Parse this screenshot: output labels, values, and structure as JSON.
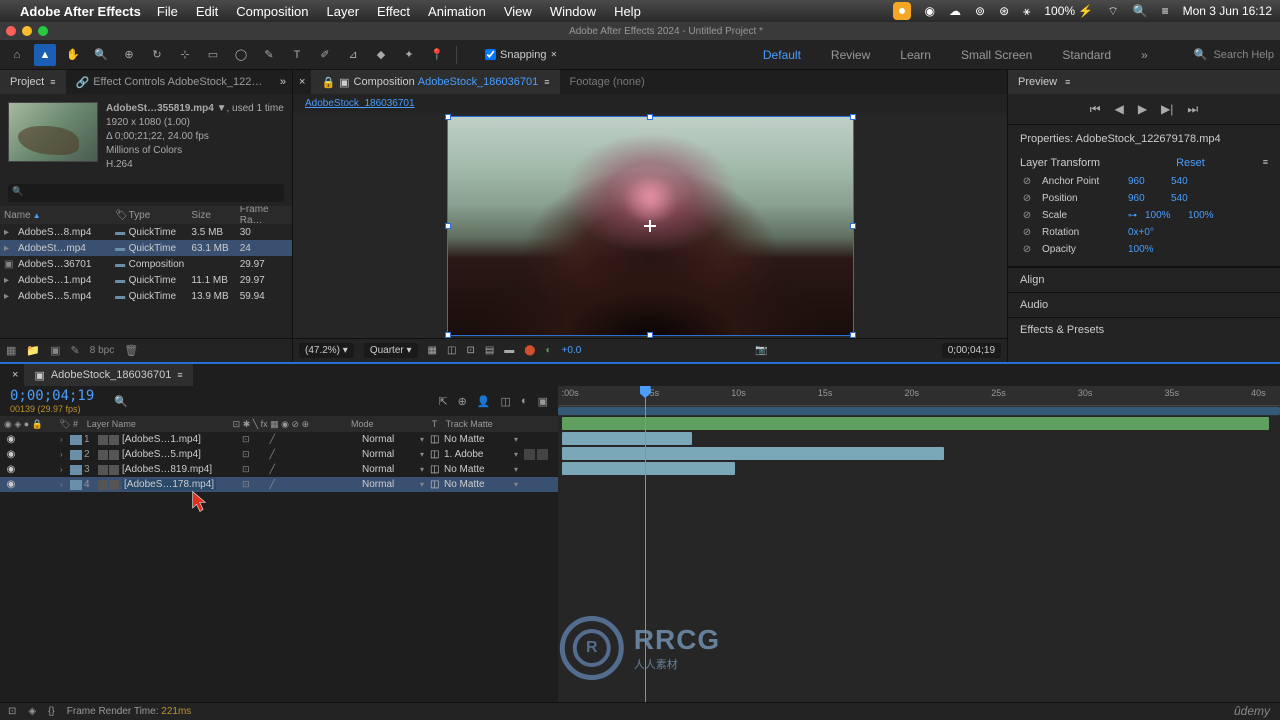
{
  "menubar": {
    "appname": "Adobe After Effects",
    "menus": [
      "File",
      "Edit",
      "Composition",
      "Layer",
      "Effect",
      "Animation",
      "View",
      "Window",
      "Help"
    ],
    "battery": "100%",
    "bt_icon": "⚡",
    "datetime": "Mon 3 Jun 16:12"
  },
  "window_title": "Adobe After Effects 2024 - Untitled Project *",
  "snapping_label": "Snapping",
  "workspaces": {
    "default": "Default",
    "review": "Review",
    "learn": "Learn",
    "small": "Small Screen",
    "standard": "Standard"
  },
  "search_help": "Search Help",
  "project": {
    "tab_project": "Project",
    "tab_effect_controls": "Effect Controls AdobeStock_122…",
    "thumb_info": {
      "name": "AdobeSt…355819.mp4 ▼",
      "used": ", used 1 time",
      "dims": "1920 x 1080 (1.00)",
      "dur": "Δ 0;00;21;22, 24.00 fps",
      "colors": "Millions of Colors",
      "codec": "H.264"
    },
    "search_placeholder": "",
    "cols": {
      "name": "Name",
      "type": "Type",
      "size": "Size",
      "fr": "Frame Ra…"
    },
    "rows": [
      {
        "name": "AdobeS…8.mp4",
        "type": "QuickTime",
        "size": "3.5 MB",
        "fr": "30",
        "sel": false
      },
      {
        "name": "AdobeSt…mp4",
        "type": "QuickTime",
        "size": "63.1 MB",
        "fr": "24",
        "sel": true
      },
      {
        "name": "AdobeS…36701",
        "type": "Composition",
        "size": "",
        "fr": "29.97",
        "sel": false
      },
      {
        "name": "AdobeS…1.mp4",
        "type": "QuickTime",
        "size": "11.1 MB",
        "fr": "29.97",
        "sel": false
      },
      {
        "name": "AdobeS…5.mp4",
        "type": "QuickTime",
        "size": "13.9 MB",
        "fr": "59.94",
        "sel": false
      }
    ],
    "bpc": "8 bpc"
  },
  "comp": {
    "tab_label": "Composition",
    "tab_name": "AdobeStock_186036701",
    "footage_tab": "Footage (none)",
    "crumb": "AdobeStock_186036701",
    "zoom": "(47.2%)",
    "quality": "Quarter",
    "exposure": "+0.0",
    "timecode": "0;00;04;19"
  },
  "preview": {
    "title": "Preview"
  },
  "properties": {
    "title": "Properties: AdobeStock_122679178.mp4",
    "section": "Layer Transform",
    "reset": "Reset",
    "anchor_lbl": "Anchor Point",
    "anchor_x": "960",
    "anchor_y": "540",
    "position_lbl": "Position",
    "pos_x": "960",
    "pos_y": "540",
    "scale_lbl": "Scale",
    "scale_x": "100%",
    "scale_y": "100%",
    "rotation_lbl": "Rotation",
    "rotation_v": "0x+0°",
    "opacity_lbl": "Opacity",
    "opacity_v": "100%"
  },
  "panels": {
    "align": "Align",
    "audio": "Audio",
    "effects": "Effects & Presets"
  },
  "timeline": {
    "tab_name": "AdobeStock_186036701",
    "timecode": "0;00;04;19",
    "frame": "00139 (29.97 fps)",
    "cols": {
      "layer_name": "Layer Name",
      "mode": "Mode",
      "track_matte": "Track Matte",
      "num": "#",
      "t": "T"
    },
    "layers": [
      {
        "num": "1",
        "name": "[AdobeS…1.mp4]",
        "mode": "Normal",
        "matte": "No Matte",
        "sel": false,
        "mex": false
      },
      {
        "num": "2",
        "name": "[AdobeS…5.mp4]",
        "mode": "Normal",
        "matte": "1. Adobe",
        "sel": false,
        "mex": true
      },
      {
        "num": "3",
        "name": "[AdobeS…819.mp4]",
        "mode": "Normal",
        "matte": "No Matte",
        "sel": false,
        "mex": false
      },
      {
        "num": "4",
        "name": "[AdobeS…178.mp4]",
        "mode": "Normal",
        "matte": "No Matte",
        "sel": true,
        "mex": false
      }
    ],
    "ruler": [
      ":00s",
      "05s",
      "10s",
      "15s",
      "20s",
      "25s",
      "30s",
      "35s",
      "40s"
    ],
    "playhead_pct": 12
  },
  "statusbar": {
    "render_label": "Frame Render Time:",
    "render_value": "221ms"
  },
  "watermark": {
    "main": "RRCG",
    "sub": "人人素材"
  },
  "udemy": "ûdemy"
}
